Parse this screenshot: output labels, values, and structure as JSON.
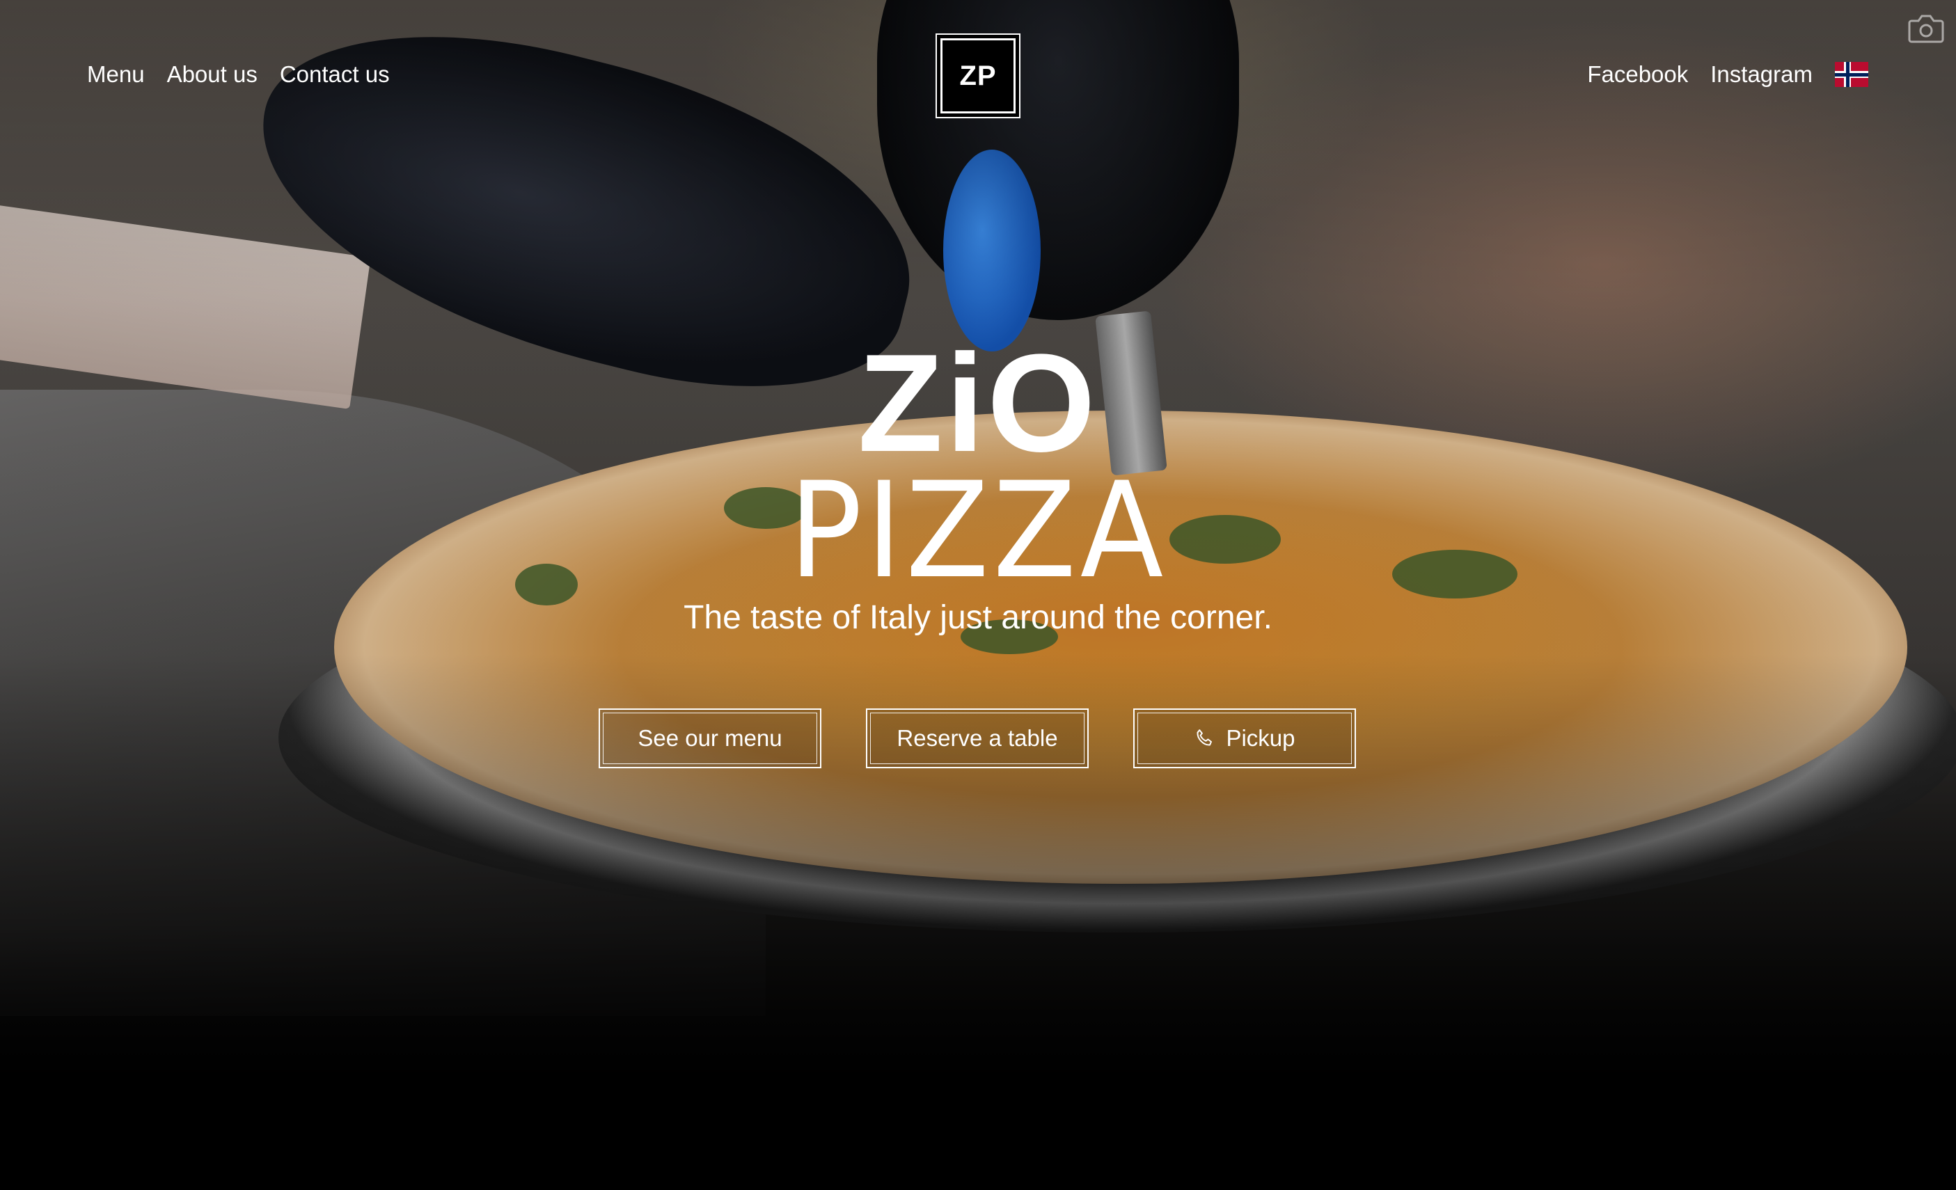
{
  "nav": {
    "left": [
      {
        "label": "Menu"
      },
      {
        "label": "About us"
      },
      {
        "label": "Contact us"
      }
    ],
    "right": [
      {
        "label": "Facebook"
      },
      {
        "label": "Instagram"
      }
    ],
    "language_flag": "norway-flag-icon"
  },
  "logo": {
    "text": "ZP"
  },
  "hero": {
    "brand_top": "ZiO",
    "brand_bottom": "PIZZA",
    "tagline": "The taste of Italy just around the corner.",
    "buttons": {
      "menu": "See our menu",
      "reserve": "Reserve a table",
      "pickup": "Pickup"
    }
  },
  "icons": {
    "camera": "camera-icon",
    "phone": "phone-icon"
  },
  "colors": {
    "text": "#ffffff",
    "background": "#000000",
    "flag_red": "#ba0c2f",
    "flag_blue": "#00205b"
  }
}
